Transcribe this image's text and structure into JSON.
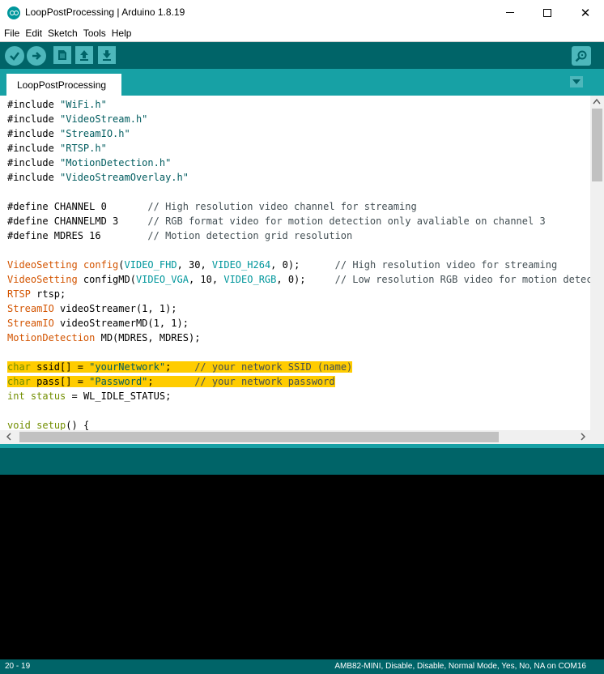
{
  "window": {
    "title": "LoopPostProcessing | Arduino 1.8.19",
    "minimize_glyph": "",
    "close_glyph": "✕"
  },
  "menu": [
    "File",
    "Edit",
    "Sketch",
    "Tools",
    "Help"
  ],
  "toolbar": {
    "verify_icon": "check-icon",
    "upload_icon": "arrow-right-icon",
    "new_icon": "new-file-icon",
    "open_icon": "arrow-up-icon",
    "save_icon": "arrow-down-icon",
    "serial_icon": "magnifier-icon"
  },
  "tabs": [
    {
      "label": "LoopPostProcessing"
    }
  ],
  "code": [
    [
      {
        "t": "#include ",
        "c": ""
      },
      {
        "t": "\"WiFi.h\"",
        "c": "str"
      }
    ],
    [
      {
        "t": "#include ",
        "c": ""
      },
      {
        "t": "\"VideoStream.h\"",
        "c": "str"
      }
    ],
    [
      {
        "t": "#include ",
        "c": ""
      },
      {
        "t": "\"StreamIO.h\"",
        "c": "str"
      }
    ],
    [
      {
        "t": "#include ",
        "c": ""
      },
      {
        "t": "\"RTSP.h\"",
        "c": "str"
      }
    ],
    [
      {
        "t": "#include ",
        "c": ""
      },
      {
        "t": "\"MotionDetection.h\"",
        "c": "str"
      }
    ],
    [
      {
        "t": "#include ",
        "c": ""
      },
      {
        "t": "\"VideoStreamOverlay.h\"",
        "c": "str"
      }
    ],
    [],
    [
      {
        "t": "#define CHANNEL 0       ",
        "c": ""
      },
      {
        "t": "// High resolution video channel for streaming",
        "c": "cmt"
      }
    ],
    [
      {
        "t": "#define CHANNELMD 3     ",
        "c": ""
      },
      {
        "t": "// RGB format video for motion detection only avaliable on channel 3",
        "c": "cmt"
      }
    ],
    [
      {
        "t": "#define MDRES 16        ",
        "c": ""
      },
      {
        "t": "// Motion detection grid resolution",
        "c": "cmt"
      }
    ],
    [],
    [
      {
        "t": "VideoSetting",
        "c": "type"
      },
      {
        "t": " ",
        "c": ""
      },
      {
        "t": "config",
        "c": "fn"
      },
      {
        "t": "(",
        "c": ""
      },
      {
        "t": "VIDEO_FHD",
        "c": "const"
      },
      {
        "t": ", 30, ",
        "c": ""
      },
      {
        "t": "VIDEO_H264",
        "c": "const"
      },
      {
        "t": ", 0);      ",
        "c": ""
      },
      {
        "t": "// High resolution video for streaming",
        "c": "cmt"
      }
    ],
    [
      {
        "t": "VideoSetting",
        "c": "type"
      },
      {
        "t": " configMD(",
        "c": ""
      },
      {
        "t": "VIDEO_VGA",
        "c": "const"
      },
      {
        "t": ", 10, ",
        "c": ""
      },
      {
        "t": "VIDEO_RGB",
        "c": "const"
      },
      {
        "t": ", 0);     ",
        "c": ""
      },
      {
        "t": "// Low resolution RGB video for motion detection",
        "c": "cmt"
      }
    ],
    [
      {
        "t": "RTSP",
        "c": "type"
      },
      {
        "t": " rtsp;",
        "c": ""
      }
    ],
    [
      {
        "t": "StreamIO",
        "c": "type"
      },
      {
        "t": " videoStreamer(1, 1);",
        "c": ""
      }
    ],
    [
      {
        "t": "StreamIO",
        "c": "type"
      },
      {
        "t": " videoStreamerMD(1, 1);",
        "c": ""
      }
    ],
    [
      {
        "t": "MotionDetection",
        "c": "type"
      },
      {
        "t": " MD(MDRES, MDRES);",
        "c": ""
      }
    ],
    [],
    [
      {
        "t": "char",
        "c": "kw"
      },
      {
        "t": " ssid[] = ",
        "c": ""
      },
      {
        "t": "\"yourNetwork\"",
        "c": "str"
      },
      {
        "t": ";    ",
        "c": ""
      },
      {
        "t": "// your network SSID (name)",
        "c": "cmt"
      }
    ],
    [
      {
        "t": "char",
        "c": "kw"
      },
      {
        "t": " pass[] = ",
        "c": ""
      },
      {
        "t": "\"Password\"",
        "c": "str"
      },
      {
        "t": ";       ",
        "c": ""
      },
      {
        "t": "// your network password",
        "c": "cmt"
      }
    ],
    [
      {
        "t": "int",
        "c": "kw"
      },
      {
        "t": " ",
        "c": ""
      },
      {
        "t": "status",
        "c": "kw"
      },
      {
        "t": " = WL_IDLE_STATUS;",
        "c": ""
      }
    ],
    [],
    [
      {
        "t": "void",
        "c": "kw"
      },
      {
        "t": " ",
        "c": ""
      },
      {
        "t": "setup",
        "c": "kw"
      },
      {
        "t": "() {",
        "c": ""
      }
    ]
  ],
  "highlighted_lines": [
    18,
    19
  ],
  "status": {
    "line": "20 - 19",
    "board": "AMB82-MINI, Disable, Disable, Normal Mode, Yes, No, NA on COM16"
  },
  "colors": {
    "teal_dark": "#006468",
    "teal_tab": "#17a1a5",
    "button": "#4db7bb",
    "highlight": "#ffcc00"
  }
}
